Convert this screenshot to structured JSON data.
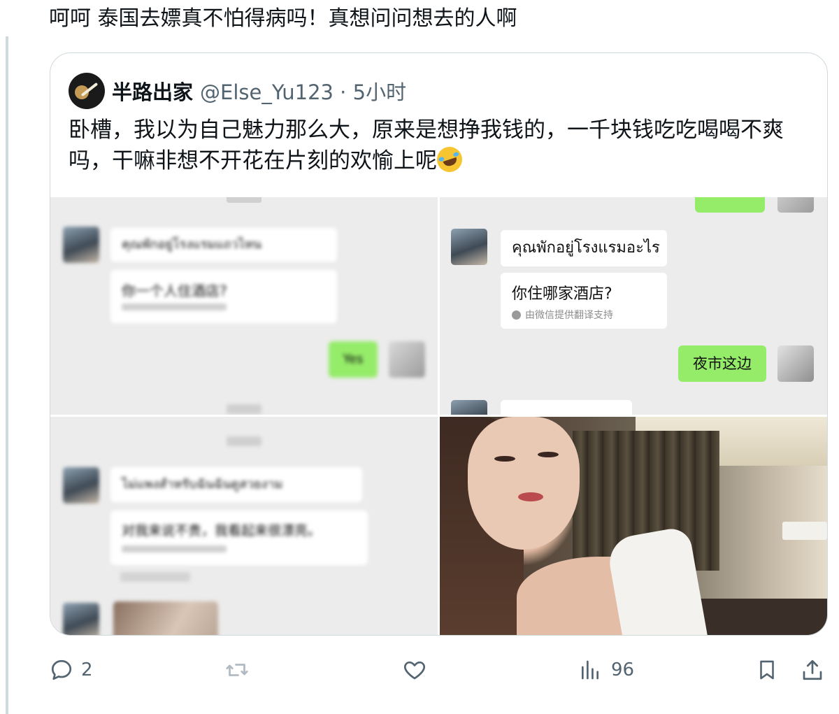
{
  "post": {
    "text": "呵呵 泰国去嫖真不怕得病吗！真想问问想去的人啊"
  },
  "quote": {
    "author_name": "半路出家",
    "handle_time": "@Else_Yu123 · 5小时",
    "text": "卧槽，我以为自己魅力那么大，原来是想挣我钱的，一千块钱吃吃喝喝不爽吗，干嘛非想不开花在片刻的欢愉上呢",
    "emoji": "rolling-on-floor-laughing"
  },
  "media": {
    "chat2": {
      "thai_question": "คุณพักอยู่โรงแรมอะไร",
      "translation": "你住哪家酒店?",
      "translation_note": "由微信提供翻译支持",
      "reply": "夜市这边"
    },
    "blurred": {
      "c1_thai": "คุณพักอยู่โรงแรมแถวไหน",
      "c1_zh": "你一个人住酒店?",
      "c1_reply": "Yes",
      "c3_thai": "ไม่แพงสำหรับฉันฉันดูสวยงาม",
      "c3_zh": "对我来说不贵，我看起来很漂亮。"
    }
  },
  "actions": {
    "replies": "2",
    "views": "96"
  },
  "colors": {
    "text": "#0f1419",
    "muted": "#536471",
    "border": "#cfd9de",
    "wechat_green": "#95ec69"
  }
}
